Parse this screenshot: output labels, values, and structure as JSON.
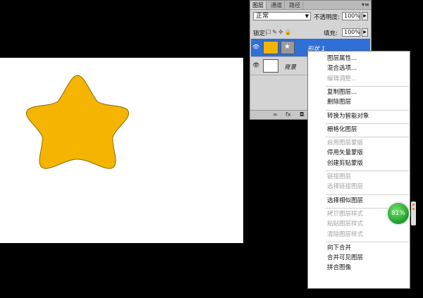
{
  "layers_panel": {
    "tabs": [
      "图层",
      "通道",
      "路径"
    ],
    "blend_mode": "正常",
    "opacity_label": "不透明度:",
    "opacity_value": "100%",
    "lock_label": "锁定:",
    "fill_label": "填充:",
    "fill_value": "100%",
    "layers": [
      {
        "name": "形状 1",
        "selected": true,
        "thumb_color": "#f5b400"
      },
      {
        "name": "背景",
        "selected": false,
        "thumb_color": "#ffffff"
      }
    ]
  },
  "context_menu": {
    "items": [
      {
        "label": "图层属性...",
        "enabled": true
      },
      {
        "label": "混合选项...",
        "enabled": true
      },
      {
        "label": "编辑调整...",
        "enabled": false
      },
      {
        "sep": true
      },
      {
        "label": "复制图层...",
        "enabled": true
      },
      {
        "label": "删除图层",
        "enabled": true
      },
      {
        "sep": true
      },
      {
        "label": "转换为智能对象",
        "enabled": true
      },
      {
        "sep": true
      },
      {
        "label": "栅格化图层",
        "enabled": true
      },
      {
        "sep": true
      },
      {
        "label": "启用图层蒙版",
        "enabled": false
      },
      {
        "label": "停用矢量蒙版",
        "enabled": true
      },
      {
        "label": "创建剪贴蒙版",
        "enabled": true
      },
      {
        "sep": true
      },
      {
        "label": "链接图层",
        "enabled": false
      },
      {
        "label": "选择链接图层",
        "enabled": false
      },
      {
        "sep": true
      },
      {
        "label": "选择相似图层",
        "enabled": true
      },
      {
        "sep": true
      },
      {
        "label": "拷贝图层样式",
        "enabled": false
      },
      {
        "label": "粘贴图层样式",
        "enabled": false
      },
      {
        "label": "清除图层样式",
        "enabled": false
      },
      {
        "sep": true
      },
      {
        "label": "向下合并",
        "enabled": true
      },
      {
        "label": "合并可见图层",
        "enabled": true
      },
      {
        "label": "拼合图像",
        "enabled": true
      }
    ]
  },
  "speed_badge": {
    "value": "81%"
  },
  "colors": {
    "star": "#f5b400",
    "selection": "#2f6fd6",
    "badge": "#2fae3b"
  }
}
